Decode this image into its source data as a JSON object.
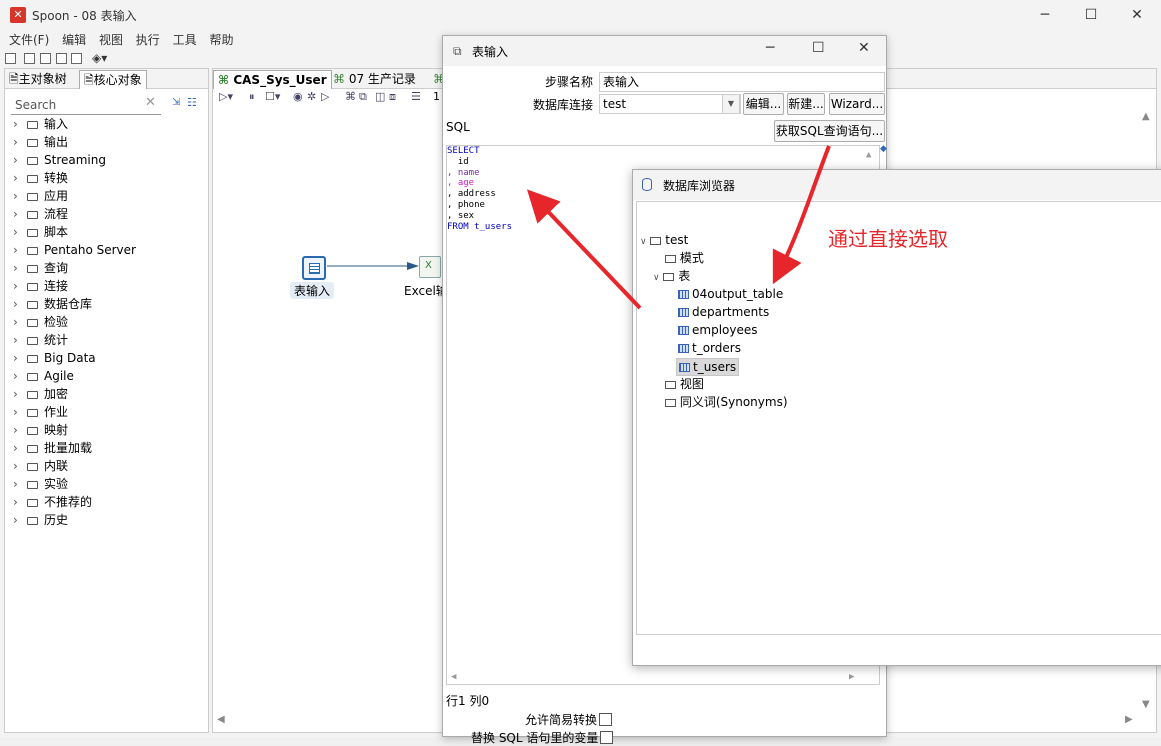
{
  "app": {
    "title": "Spoon - 08 表输入",
    "logo": "spoon-logo"
  },
  "menu": [
    "文件(F)",
    "编辑",
    "视图",
    "执行",
    "工具",
    "帮助"
  ],
  "left_panel": {
    "tabs": [
      "主对象树",
      "核心对象"
    ],
    "search_placeholder": "Search",
    "tree": [
      "输入",
      "输出",
      "Streaming",
      "转换",
      "应用",
      "流程",
      "脚本",
      "Pentaho Server",
      "查询",
      "连接",
      "数据仓库",
      "检验",
      "统计",
      "Big Data",
      "Agile",
      "加密",
      "作业",
      "映射",
      "批量加载",
      "内联",
      "实验",
      "不推荐的",
      "历史"
    ]
  },
  "center": {
    "tabs": [
      "CAS_Sys_User",
      "07 生产记录"
    ],
    "steps": [
      {
        "label": "表输入"
      },
      {
        "label": "Excel输"
      }
    ],
    "zoom_fragment": "1"
  },
  "dialog": {
    "title": "表输入",
    "step_name_label": "步骤名称",
    "step_name_value": "表输入",
    "db_conn_label": "数据库连接",
    "db_conn_value": "test",
    "edit_button": "编辑...",
    "new_button": "新建...",
    "wizard_button": "Wizard...",
    "sql_label": "SQL",
    "get_sql_button": "获取SQL查询语句...",
    "sql_lines": [
      "SELECT",
      "  id",
      ", name",
      ", age",
      ", address",
      ", phone",
      ", sex",
      "FROM t_users"
    ],
    "status": "行1 列0",
    "simple_conversion_label": "允许简易转换",
    "replace_vars_label": "替换 SQL 语句里的变量"
  },
  "browser": {
    "title": "数据库浏览器",
    "root": "test",
    "schemas": "模式",
    "tables_label": "表",
    "tables": [
      "04output_table",
      "departments",
      "employees",
      "t_orders",
      "t_users"
    ],
    "selected_table": "t_users",
    "views": "视图",
    "synonyms": "同义词(Synonyms)"
  },
  "annotation": {
    "text": "通过直接选取",
    "color": "#e6262a"
  },
  "colors": {
    "accent": "#2a6ab3",
    "sql_keyword": "#0000c0",
    "sql_pink": "#d020d0",
    "sql_purple": "#7a2fa0"
  }
}
